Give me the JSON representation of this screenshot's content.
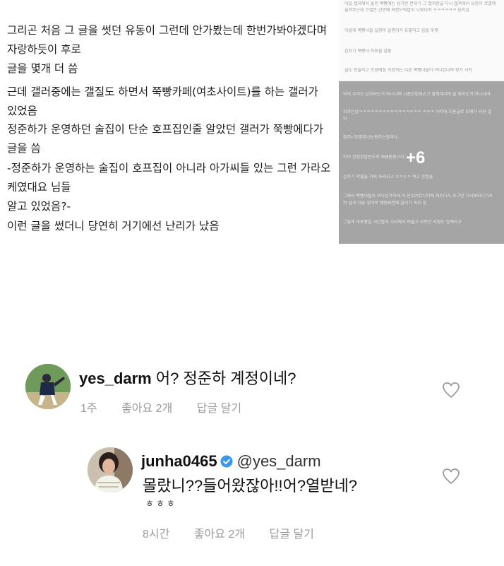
{
  "article": {
    "paragraphs": [
      "그리곤 처음 그 글을 썻던 유동이 그런데 안가봤는데 한번가봐야겠다며 자랑하듯이 후로\n글을 몇개 더 씀",
      "근데 갤러중에는 갤질도 하면서 쭉빵카페(여초사이트)를 하는 갤러가 있었음",
      "정준하가 운영하던 술집이 단순 호프집인줄 알았던 갤러가 쭉빵에다가 글을 씀",
      "-정준하가 운영하는 술집이 호프집이 아니라 아가씨들 있는 그런 가라오케였대요 님들\n알고 있었음?-",
      "이런 글을 썼더니 당연히 거기에선 난리가 났음"
    ]
  },
  "thumbnail": {
    "lines": [
      "이걸 캡쳐해서 올린 쭉빵에는 심각한 분위기 그 캡쳐한글 다시 캡쳐해서 유동이 코갤에",
      "올려주는데 코갤은 간만에 레전드떡밥이 나왔다며 ㅋㅋㅋㅋㅋㅋ 난리남",
      "이렇게 쭉빵녀들 실장의 실명이가 유출되고 갑들 뚜렷",
      "갑자기 쭉빵녀 자취를 감춤",
      "글도 안올리고 조용해짐 걱정하는 다른 쭉빵녀들이 어디갔냐며 찾기 시작"
    ],
    "gray_lines": [
      "되어 우리도 남자되는거 아니냐며 시켰던집회쇼고 황해하다며 답 쥐지는거 아니냐며",
      "모르는남ㅋㅋㅋㅋㅋㅋㅋㅋㅋㅋㅋㅋㅋㅋㅋㅋ ㅋㅋㅋ 어떠네 조용글로 도배가 되던 걸",
      "이",
      "정주나인정주나눈원주는장하나",
      "하여 한정정말인도로 재생판화고이",
      "갑자기 약물을 거의 사라지고 ㅎㅋㅎㅋ 찍고 한정을",
      "그래서 쭉빵녀들이 외나선가하게 어 온갖커뮤니티에 퍼지다가 초그만 기사화되나기사",
      "작 결국 다음 네이버 메인화면에 걸리기 까지 함",
      "그렇게 하루종일 시간별게 기사에서 퍼들고 모르던 사람도 알게되고"
    ],
    "more_count": "+6"
  },
  "comments": [
    {
      "username": "yes_darm",
      "text": "어? 정준하 계정이네?",
      "time": "1주",
      "likes": "좋아요 2개",
      "reply": "답글 달기"
    },
    {
      "username": "junha0465",
      "mention": "@yes_darm",
      "text": "몰랐니??들어왔잖아!!어?열받네?",
      "text2": "ㅎㅎㅎ",
      "time": "8시간",
      "likes": "좋아요 2개",
      "reply": "답글 달기"
    }
  ],
  "colors": {
    "verified": "#3897f0",
    "meta": "#9a9a9a",
    "thumb_overlay": "#a5a5a5"
  },
  "icons": [
    "heart-icon",
    "verified-icon"
  ]
}
